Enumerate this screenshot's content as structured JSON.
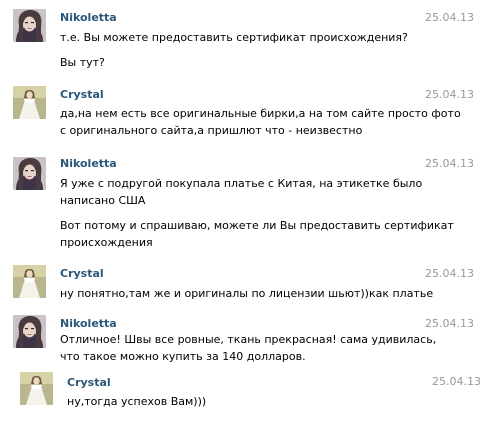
{
  "messages": [
    {
      "author": "Nikoletta",
      "avatar": "nikoletta-avatar",
      "date": "25.04.13",
      "paragraphs": [
        [
          "т.е. Вы можете предоставить сертификат происхождения?"
        ],
        [
          "Вы тут?"
        ]
      ]
    },
    {
      "author": "Crystal",
      "avatar": "crystal-avatar",
      "date": "25.04.13",
      "paragraphs": [
        [
          "да,на нем есть все оригинальные бирки,а на том сайте просто фото",
          "с оригинального сайта,а пришлют что - неизвестно"
        ]
      ]
    },
    {
      "author": "Nikoletta",
      "avatar": "nikoletta-avatar",
      "date": "25.04.13",
      "paragraphs": [
        [
          "Я уже с подругой покупала платье с Китая, на этикетке было",
          "написано США"
        ],
        [
          "Вот потому и спрашиваю, можете ли Вы предоставить сертификат",
          "происхождения"
        ]
      ]
    },
    {
      "author": "Crystal",
      "avatar": "crystal-avatar",
      "date": "25.04.13",
      "paragraphs": [
        [
          "ну понятно,там же и оригиналы по лицензии шьют))как платье"
        ]
      ]
    },
    {
      "author": "Nikoletta",
      "avatar": "nikoletta-avatar",
      "date": "25.04.13",
      "paragraphs": [
        [
          "Отличное! Швы все ровные, ткань прекрасная! сама удивилась,",
          "что такое можно купить за 140 долларов."
        ]
      ]
    },
    {
      "author": "Crystal",
      "avatar": "crystal-avatar",
      "date": "25.04.13",
      "paragraphs": [
        [
          "ну,тогда успехов Вам)))"
        ]
      ]
    }
  ]
}
